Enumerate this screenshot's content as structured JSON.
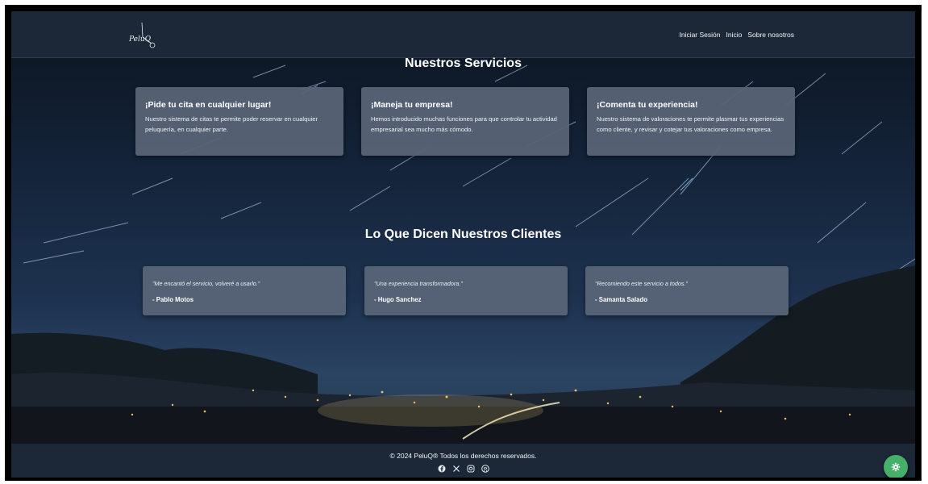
{
  "navbar": {
    "logo_text": "PeluQ",
    "links": [
      "Iniciar Sesión",
      "Inicio",
      "Sobre nosotros"
    ]
  },
  "services": {
    "title": "Nuestros Servicios",
    "cards": [
      {
        "title": "¡Pide tu cita en cualquier lugar!",
        "text": "Nuestro sistema de citas te permite poder reservar en cualquier peluquería, en cualquier parte."
      },
      {
        "title": "¡Maneja tu empresa!",
        "text": "Hemos introducido muchas funciones para que controlar tu actividad empresarial sea mucho más cómodo."
      },
      {
        "title": "¡Comenta tu experiencia!",
        "text": "Nuestro sistema de valoraciones te permite plasmar tus experiencias como cliente, y revisar y cotejar tus valoraciones como empresa."
      }
    ]
  },
  "testimonials": {
    "title": "Lo Que Dicen Nuestros Clientes",
    "items": [
      {
        "quote": "\"Me encantó el servicio, volveré a usarlo.\"",
        "author": "- Pablo Motos"
      },
      {
        "quote": "\"Una experiencia transformadora.\"",
        "author": "- Hugo Sanchez"
      },
      {
        "quote": "\"Recomiendo este servicio a todos.\"",
        "author": "- Samanta Salado"
      }
    ]
  },
  "footer": {
    "copyright": "© 2024 PeluQ® Todos los derechos reservados.",
    "socials": [
      "facebook-icon",
      "x-icon",
      "instagram-icon",
      "github-icon"
    ]
  },
  "settings_icon": "gear-icon",
  "colors": {
    "navbar_bg": "#1c2737",
    "card_bg": "#586476",
    "accent_green": "#46b06a"
  }
}
